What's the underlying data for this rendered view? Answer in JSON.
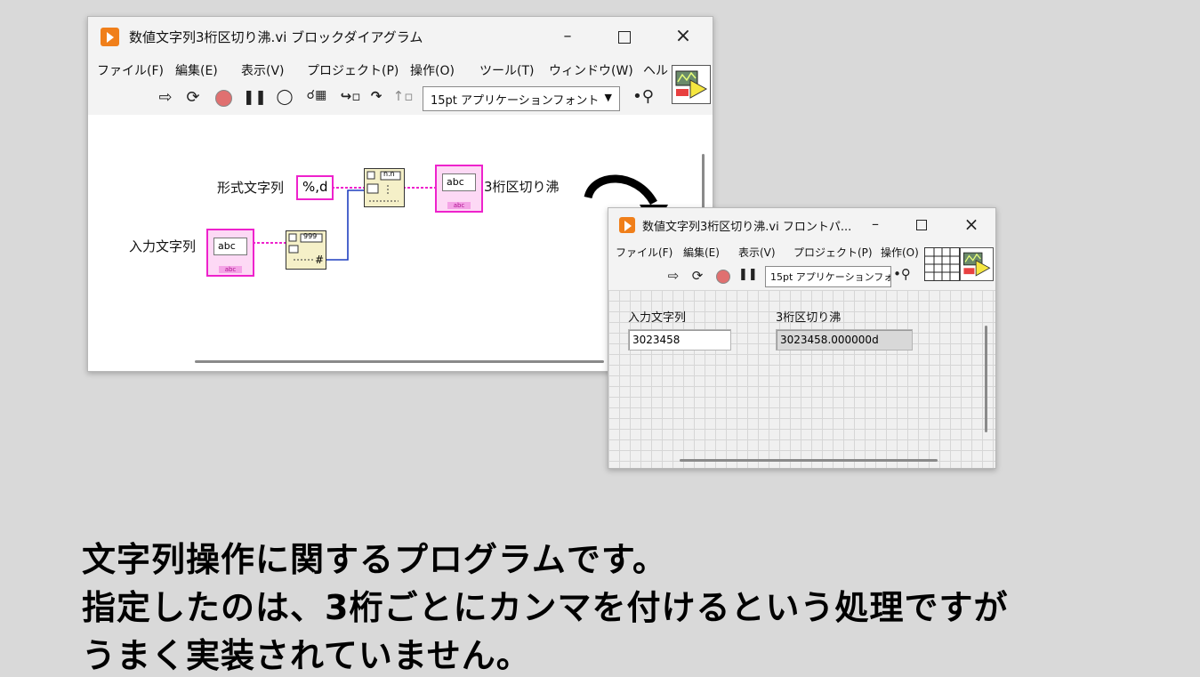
{
  "block_diagram": {
    "title": "数値文字列3桁区切り沸.vi ブロックダイアグラム",
    "menu": [
      "ファイル(F)",
      "編集(E)",
      "表示(V)",
      "プロジェクト(P)",
      "操作(O)",
      "ツール(T)",
      "ウィンドウ(W)",
      "ヘル"
    ],
    "font_select": "15pt アプリケーションフォント",
    "format_label": "形式文字列",
    "format_value": "%,d",
    "input_label": "入力文字列",
    "input_inner": "abc",
    "input_tag": "abc",
    "output_label": "3桁区切り沸",
    "output_inner": "abc",
    "output_tag": "abc",
    "func1_top": "n.n",
    "func2_top": "999",
    "func2_bottom": "#"
  },
  "front_panel": {
    "title": "数値文字列3桁区切り沸.vi フロントパ...",
    "menu": [
      "ファイル(F)",
      "編集(E)",
      "表示(V)",
      "プロジェクト(P)",
      "操作(O)"
    ],
    "font_select": "15pt アプリケーションフォ",
    "input_label": "入力文字列",
    "input_value": "3023458",
    "output_label": "3桁区切り沸",
    "output_value": "3023458.000000d"
  },
  "caption": {
    "line1": "文字列操作に関するプログラムです。",
    "line2": "指定したのは、3桁ごとにカンマを付けるという処理ですが",
    "line3": "うまく実装されていません。"
  },
  "colors": {
    "string_wire": "#ee22cc",
    "numeric_wire": "#1f3fbf",
    "labview_orange": "#f07f1a"
  }
}
